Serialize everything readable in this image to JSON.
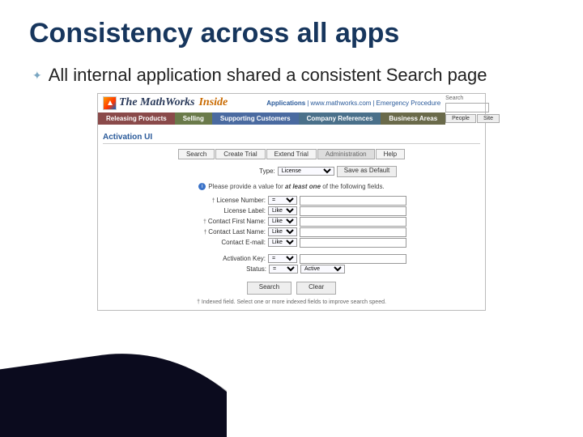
{
  "slide": {
    "title": "Consistency across all apps",
    "bullet": "All internal application shared a consistent Search page"
  },
  "header": {
    "brand_main": "The MathWorks",
    "brand_sub": "Inside",
    "top_links": [
      "Applications",
      "www.mathworks.com",
      "Emergency Procedure"
    ],
    "search_label": "Search",
    "tab_people": "People",
    "tab_site": "Site"
  },
  "nav": [
    "Releasing Products",
    "Selling",
    "Supporting Customers",
    "Company References",
    "Business Areas"
  ],
  "section_title": "Activation UI",
  "subnav": {
    "search": "Search",
    "create": "Create Trial",
    "extend": "Extend Trial",
    "admin": "Administration",
    "help": "Help"
  },
  "type_row": {
    "label": "Type:",
    "selected": "License",
    "save_btn": "Save as Default"
  },
  "hint_prefix": "Please provide a value for ",
  "hint_em": "at least one",
  "hint_suffix": " of the following fields.",
  "fields": {
    "license_number": {
      "label": "License Number:",
      "op": "="
    },
    "license_label": {
      "label": "License Label:",
      "op": "Like"
    },
    "first_name": {
      "label": "Contact First Name:",
      "op": "Like"
    },
    "last_name": {
      "label": "Contact Last Name:",
      "op": "Like"
    },
    "email": {
      "label": "Contact E-mail:",
      "op": "Like"
    },
    "activation_key": {
      "label": "Activation Key:",
      "op": "="
    },
    "status": {
      "label": "Status:",
      "op": "=",
      "val": "Active"
    }
  },
  "buttons": {
    "search": "Search",
    "clear": "Clear"
  },
  "footnote": "†  Indexed field. Select one or more indexed fields to improve search speed."
}
